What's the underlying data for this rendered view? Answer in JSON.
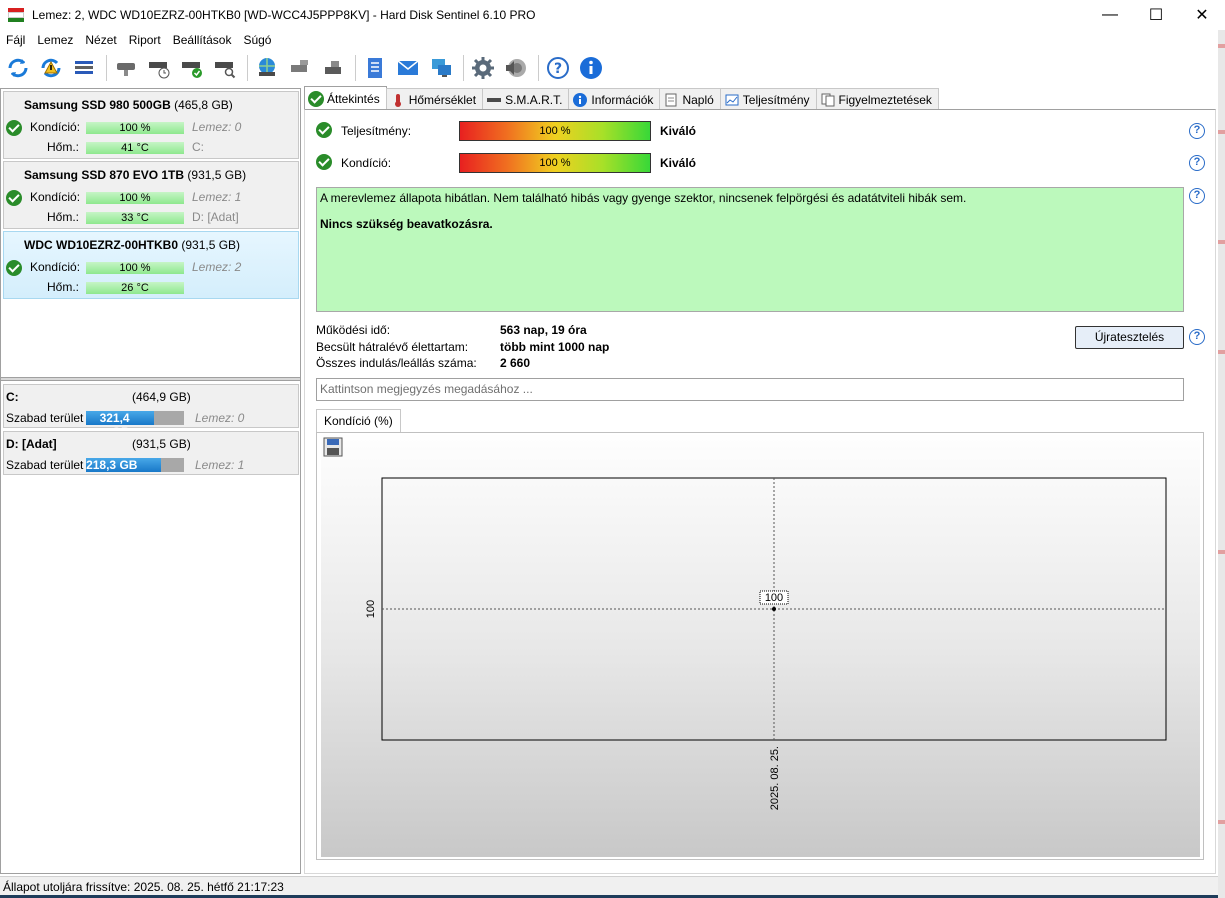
{
  "window": {
    "title": "Lemez: 2, WDC WD10EZRZ-00HTKB0 [WD-WCC4J5PPP8KV]  -  Hard Disk Sentinel 6.10 PRO",
    "minimize": "—",
    "maximize": "☐",
    "close": "✕"
  },
  "menu": [
    "Fájl",
    "Lemez",
    "Nézet",
    "Riport",
    "Beállítások",
    "Súgó"
  ],
  "disks": [
    {
      "name": "Samsung SSD 980 500GB",
      "size": "(465,8 GB)",
      "kondicio_label": "Kondíció:",
      "kondicio": "100 %",
      "lemez": "Lemez: 0",
      "hom_label": "Hőm.:",
      "hom": "41 °C",
      "part": "C:"
    },
    {
      "name": "Samsung SSD 870 EVO 1TB",
      "size": "(931,5 GB)",
      "kondicio_label": "Kondíció:",
      "kondicio": "100 %",
      "lemez": "Lemez: 1",
      "hom_label": "Hőm.:",
      "hom": "33 °C",
      "part_bold": "D:",
      "part_rest": " [Adat]"
    },
    {
      "name": "WDC WD10EZRZ-00HTKB0",
      "size": "(931,5 GB)",
      "kondicio_label": "Kondíció:",
      "kondicio": "100 %",
      "lemez": "Lemez: 2",
      "hom_label": "Hőm.:",
      "hom": "26 °C"
    }
  ],
  "volumes": [
    {
      "name": "C:",
      "size": "(464,9 GB)",
      "free_label": "Szabad terület",
      "free": "321,4 GB",
      "free_fraction": 0.69,
      "lemez": "Lemez: 0"
    },
    {
      "name": "D: [Adat]",
      "size": "(931,5 GB)",
      "free_label": "Szabad terület",
      "free": "218,3 GB",
      "free_fraction": 0.77,
      "lemez": "Lemez: 1"
    }
  ],
  "tabs": [
    "Áttekintés",
    "Hőmérséklet",
    "S.M.A.R.T.",
    "Információk",
    "Napló",
    "Teljesítmény",
    "Figyelmeztetések"
  ],
  "overview": {
    "teljesitmeny_label": "Teljesítmény:",
    "teljesitmeny_value": "100 %",
    "teljesitmeny_text": "Kiváló",
    "kondicio_label": "Kondíció:",
    "kondicio_value": "100 %",
    "kondicio_text": "Kiváló",
    "description": "A merevlemez állapota hibátlan. Nem található hibás vagy gyenge szektor, nincsenek felpörgési és adatátviteli hibák sem.",
    "action": "Nincs szükség beavatkozásra.",
    "mukodesi_label": "Működési idő:",
    "mukodesi_value": "563 nap, 19 óra",
    "elettartam_label": "Becsült hátralévő élettartam:",
    "elettartam_value": "több mint 1000 nap",
    "indulas_label": "Összes indulás/leállás száma:",
    "indulas_value": "2 660",
    "retest_button": "Újratesztelés",
    "comment_placeholder": "Kattintson megjegyzés megadásához ...",
    "help": "?"
  },
  "chart_tab": "Kondíció  (%)",
  "chart_data": {
    "type": "line",
    "x": [
      "2025. 08. 25."
    ],
    "series": [
      {
        "values": [
          100
        ]
      }
    ],
    "ytick": "100",
    "xtick": "2025. 08. 25.",
    "point_label": "100"
  },
  "status": "Állapot utoljára frissítve: 2025. 08. 25. hétfő 21:17:23"
}
